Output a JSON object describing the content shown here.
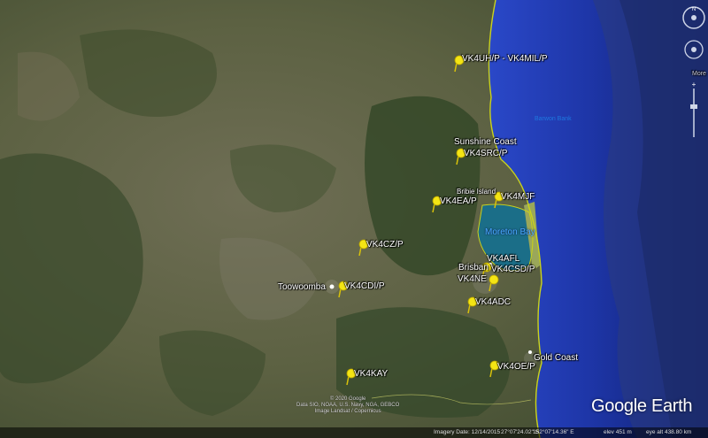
{
  "labels": {
    "vk4uh": "VK4UH/P - VK4MIL/P",
    "sunshine_coast": "Sunshine Coast",
    "vk4src": "VK4SRC/P",
    "bribie_island": "Bribie Island",
    "vk4mjf": "VK4MJF",
    "vk4ea": "VK4EA/P",
    "moreton_bay": "Moreton Bay",
    "vk4cz": "VK4CZ/P",
    "vk4afl": "VK4AFL",
    "brisbane": "Brisban",
    "vk4csd": "VK4CSD/P",
    "vk4ne": "VK4NE",
    "toowoomba": "Toowoomba",
    "vk4cdi": "VK4CDI/P",
    "vk4adc": "VK4ADC",
    "gold_coast": "Gold Coast",
    "vk4oe": "VK4OE/P",
    "vk4kay": "VK4KAY",
    "barwon_bank": "Barwon Bank"
  },
  "attribution": [
    "© 2020 Google",
    "Data SIO, NOAA, U.S. Navy, NGA, GEBCO",
    "Image Landsat / Copernicus"
  ],
  "logo": "Google Earth",
  "status": {
    "imagery_date": "Imagery Date: 12/14/2015",
    "lat": "27°07'24.02\" S",
    "lon": "152°07'14.36\" E",
    "elev": "elev   451 m",
    "eye_alt": "eye alt 438.80 km"
  },
  "nav": {
    "more_label": "More"
  },
  "colors": {
    "pin": "#f4e514",
    "coast": "#c9d21c",
    "ocean": "#1a33a0"
  }
}
